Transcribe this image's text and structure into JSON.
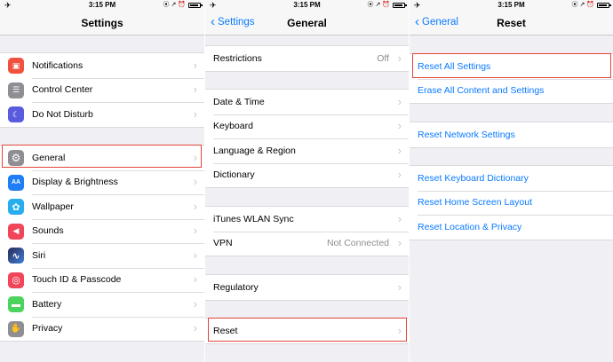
{
  "status": {
    "time": "3:15 PM",
    "plane": "✈",
    "right": "⦿ ↗ ⏰"
  },
  "colors": {
    "ios_blue": "#0a7aff",
    "highlight": "#e2453a",
    "separator": "#c8c7cc",
    "bg": "#efeff4"
  },
  "screen1": {
    "title": "Settings",
    "groups": [
      [
        {
          "label": "Notifications",
          "icon": "notifications-icon",
          "color": "#f1513f",
          "glyph": "▣"
        },
        {
          "label": "Control Center",
          "icon": "control-center-icon",
          "color": "#8e8e93",
          "glyph": "☰"
        },
        {
          "label": "Do Not Disturb",
          "icon": "moon-icon",
          "color": "#5a5ce0",
          "glyph": "☾"
        }
      ],
      [
        {
          "label": "General",
          "icon": "gear-icon",
          "color": "#8e8e93",
          "glyph": "⚙"
        },
        {
          "label": "Display & Brightness",
          "icon": "display-icon",
          "color": "#1f7ef5",
          "glyph": "AA"
        },
        {
          "label": "Wallpaper",
          "icon": "wallpaper-icon",
          "color": "#26aef0",
          "glyph": "✿"
        },
        {
          "label": "Sounds",
          "icon": "sounds-icon",
          "color": "#f1465a",
          "glyph": "◀"
        },
        {
          "label": "Siri",
          "icon": "siri-icon",
          "color": "#3b3b6b",
          "glyph": "∿"
        },
        {
          "label": "Touch ID & Passcode",
          "icon": "fingerprint-icon",
          "color": "#f1465a",
          "glyph": "◎"
        },
        {
          "label": "Battery",
          "icon": "battery-icon",
          "color": "#4cd35e",
          "glyph": "▬"
        },
        {
          "label": "Privacy",
          "icon": "hand-icon",
          "color": "#8e8e93",
          "glyph": "✋"
        }
      ]
    ]
  },
  "screen2": {
    "back": "Settings",
    "title": "General",
    "groups": [
      [
        {
          "label": "Restrictions",
          "value": "Off"
        }
      ],
      [
        {
          "label": "Date & Time"
        },
        {
          "label": "Keyboard"
        },
        {
          "label": "Language & Region"
        },
        {
          "label": "Dictionary"
        }
      ],
      [
        {
          "label": "iTunes WLAN Sync"
        },
        {
          "label": "VPN",
          "value": "Not Connected"
        }
      ],
      [
        {
          "label": "Regulatory"
        }
      ],
      [
        {
          "label": "Reset"
        }
      ]
    ]
  },
  "screen3": {
    "back": "General",
    "title": "Reset",
    "groups": [
      [
        {
          "label": "Reset All Settings"
        },
        {
          "label": "Erase All Content and Settings"
        }
      ],
      [
        {
          "label": "Reset Network Settings"
        }
      ],
      [
        {
          "label": "Reset Keyboard Dictionary"
        },
        {
          "label": "Reset Home Screen Layout"
        },
        {
          "label": "Reset Location & Privacy"
        }
      ]
    ]
  }
}
